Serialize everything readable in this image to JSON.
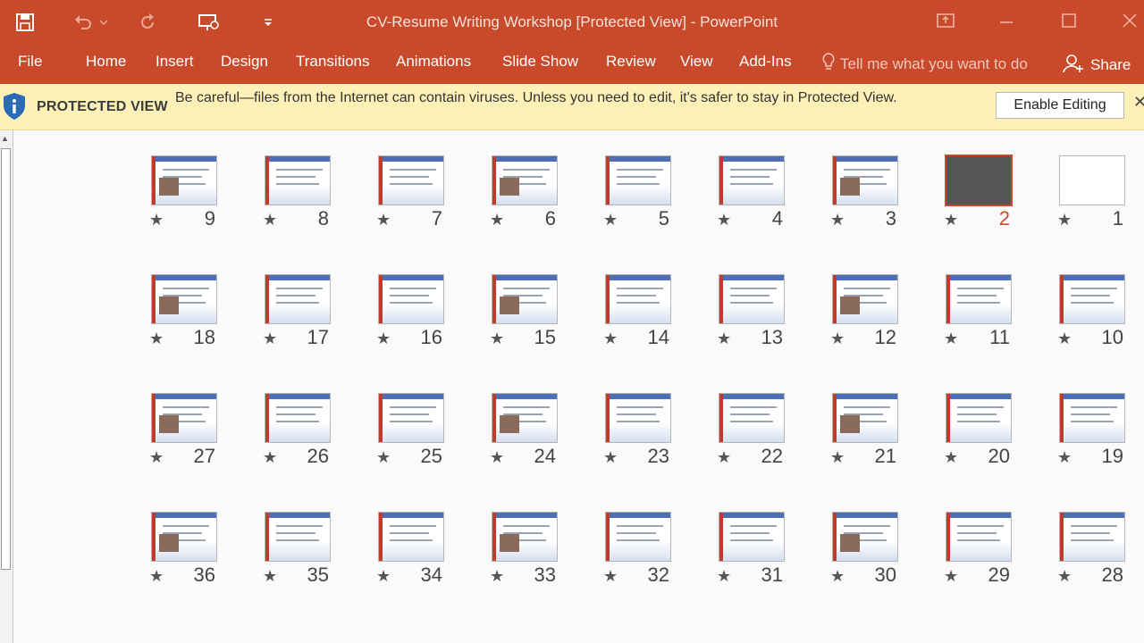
{
  "window": {
    "title": "CV-Resume Writing Workshop [Protected View] - PowerPoint"
  },
  "quick_access": {
    "icons": [
      "save-icon",
      "undo-icon",
      "redo-icon",
      "presenter-icon",
      "customize-icon"
    ]
  },
  "ribbon": {
    "tabs": [
      "File",
      "Home",
      "Insert",
      "Design",
      "Transitions",
      "Animations",
      "Slide Show",
      "Review",
      "View",
      "Add-Ins"
    ],
    "tell_me": "Tell me what you want to do",
    "share": "Share"
  },
  "protected_view": {
    "title": "PROTECTED VIEW",
    "message": "Be careful—files from the Internet can contain viruses. Unless you need to edit, it's safer to stay in Protected View.",
    "enable_button": "Enable Editing"
  },
  "slides": {
    "selected": "2",
    "rows": [
      [
        "9",
        "8",
        "7",
        "6",
        "5",
        "4",
        "3",
        "2",
        "1"
      ],
      [
        "18",
        "17",
        "16",
        "15",
        "14",
        "13",
        "12",
        "11",
        "10"
      ],
      [
        "27",
        "26",
        "25",
        "24",
        "23",
        "22",
        "21",
        "20",
        "19"
      ],
      [
        "36",
        "35",
        "34",
        "33",
        "32",
        "31",
        "30",
        "29",
        "28"
      ]
    ],
    "star": "★"
  },
  "colors": {
    "accent": "#c9492b",
    "protected_bar": "#fdf1b8"
  }
}
